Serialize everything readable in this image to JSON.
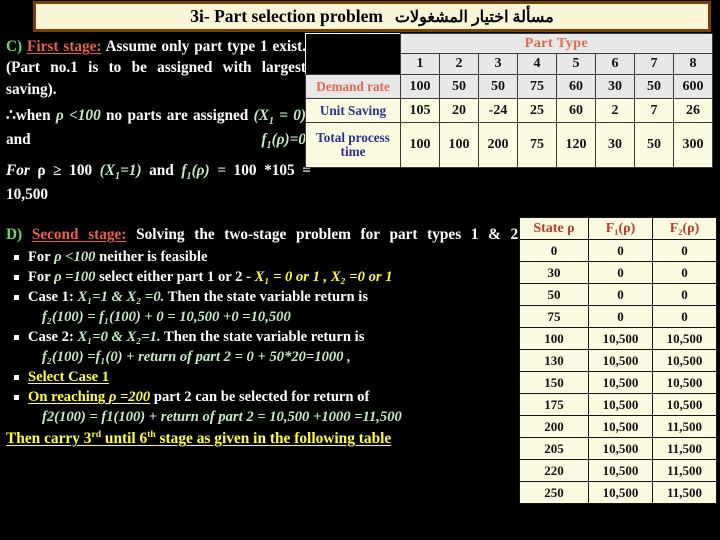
{
  "title": {
    "english": "3i- Part selection problem",
    "arabic": "مسألة اختيار  المشغولات",
    "border_color": "#7b3f00",
    "background_color": "#fbf5d8"
  },
  "section_c": {
    "marker": "C)",
    "heading": "First  stage:",
    "line1": " Assume  only part type 1 exist. (Part no.1 is to be assigned with largest saving).",
    "line2_pre": "∴when ",
    "line2_math": "ρ <100",
    "line2_mid": "  no  parts  are  assigned ",
    "line2_math2": "(X",
    "line2_sub": "1",
    "line2_math3": " = 0)",
    "line2_and": " and ",
    "line2_math4": "f",
    "line2_sub2": "1",
    "line2_math5": "(ρ)=0",
    "line3_a": "For",
    "line3_b": " ρ ≥ 100  ",
    "line3_c": "(X",
    "line3_sub": "1",
    "line3_d": "=1)",
    "line3_e": "  and  ",
    "line3_f": "f",
    "line3_sub2": "1",
    "line3_g": "(ρ) =",
    "line3_h": " 100 *105 = 10,500"
  },
  "section_d": {
    "marker": "D)",
    "heading": "Second  stage:",
    "lead": " Solving the two-stage problem for part types 1 & 2.",
    "bullets": [
      {
        "id": "bullet-rho-lt-100",
        "pre": "For ",
        "math": "ρ <100",
        "post": "  neither is feasible"
      },
      {
        "id": "bullet-rho-eq-100",
        "pre": "For ",
        "math": "ρ =100",
        "post": " select either part 1 or 2  - ",
        "highlight": "X₁ = 0 or 1 , X₂ =0 or 1"
      },
      {
        "id": "bullet-case-1",
        "pre": "Case 1: ",
        "math": "X₁=1 & X₂ =0.",
        "post": " Then the state variable return is",
        "sub": "f₂(100) = f₁(100) + 0 = 10,500 +0 =10,500"
      },
      {
        "id": "bullet-case-2",
        "pre": "Case 2: ",
        "math": "X₁=0 & X₂=1.",
        "post": " Then the state variable return is",
        "sub": "f₂(100) =f₁(0) + return of part 2 = 0 + 50*20=1000 ,"
      },
      {
        "id": "bullet-select-case-1",
        "yellow_underline": "Select Case 1"
      },
      {
        "id": "bullet-on-reaching",
        "yellow_underline": "On  reaching ",
        "math": "ρ =200",
        "post": " part 2 can be selected for return of",
        "sub": "f2(100) = f1(100) + return of part 2 = 10,500 +1000 =11,500"
      }
    ],
    "footer_a": "Then carry 3",
    "footer_sup1": "rd",
    "footer_b": " until 6",
    "footer_sup2": "th",
    "footer_c": "  stage as given in the following table"
  },
  "part_type_table": {
    "span_header": "Part Type",
    "columns": [
      "1",
      "2",
      "3",
      "4",
      "5",
      "6",
      "7",
      "8"
    ],
    "rows": [
      {
        "label": "Demand rate",
        "label_color": "#e06a4e",
        "values": [
          "100",
          "50",
          "50",
          "75",
          "60",
          "30",
          "50",
          "600"
        ]
      },
      {
        "label": "Unit Saving",
        "label_color": "#2b2f8f",
        "values": [
          "105",
          "20",
          "-24",
          "25",
          "60",
          "2",
          "7",
          "26"
        ]
      },
      {
        "label": "Total process time",
        "label_color": "#2b2f8f",
        "values": [
          "100",
          "100",
          "200",
          "75",
          "120",
          "30",
          "50",
          "300"
        ]
      }
    ]
  },
  "state_table": {
    "headers": [
      "State ρ",
      "F₁(ρ)",
      "F₂(ρ)"
    ],
    "rows": [
      [
        "0",
        "0",
        "0"
      ],
      [
        "30",
        "0",
        "0"
      ],
      [
        "50",
        "0",
        "0"
      ],
      [
        "75",
        "0",
        "0"
      ],
      [
        "100",
        "10,500",
        "10,500"
      ],
      [
        "130",
        "10,500",
        "10,500"
      ],
      [
        "150",
        "10,500",
        "10,500"
      ],
      [
        "175",
        "10,500",
        "10,500"
      ],
      [
        "200",
        "10,500",
        "11,500"
      ],
      [
        "205",
        "10,500",
        "11,500"
      ],
      [
        "220",
        "10,500",
        "11,500"
      ],
      [
        "250",
        "10,500",
        "11,500"
      ]
    ]
  },
  "colors": {
    "accent_green": "#66dd66",
    "accent_red": "#e8604a",
    "accent_yellow": "#ffff33",
    "math_green": "#c6e9c6",
    "table_cream": "#fbfbe0",
    "table_gray": "#e8e8e8",
    "header_orange": "#e06a4e",
    "header_blue": "#2b2f8f"
  }
}
